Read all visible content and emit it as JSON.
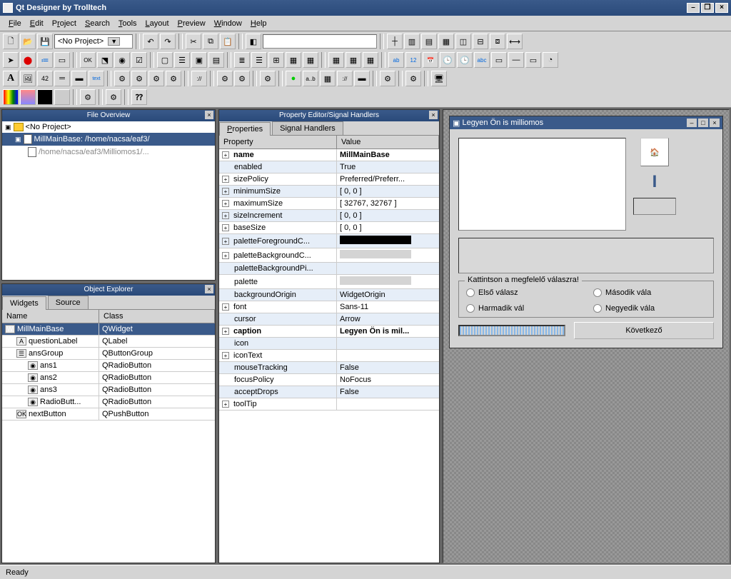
{
  "window": {
    "title": "Qt Designer by Trolltech"
  },
  "menus": [
    "File",
    "Edit",
    "Project",
    "Search",
    "Tools",
    "Layout",
    "Preview",
    "Window",
    "Help"
  ],
  "project_combo": "<No Project>",
  "panels": {
    "file_overview": {
      "title": "File Overview",
      "root": "<No Project>",
      "selected": "MillMainBase: /home/nacsa/eaf3/",
      "child": "/home/nacsa/eaf3/Milliomos1/..."
    },
    "object_explorer": {
      "title": "Object Explorer",
      "tabs": [
        "Widgets",
        "Source"
      ],
      "active_tab": 0,
      "columns": [
        "Name",
        "Class"
      ],
      "rows": [
        {
          "name": "MillMainBase",
          "class": "QWidget",
          "sel": true,
          "indent": 0,
          "icon": "W"
        },
        {
          "name": "questionLabel",
          "class": "QLabel",
          "sel": false,
          "indent": 1,
          "icon": "A"
        },
        {
          "name": "ansGroup",
          "class": "QButtonGroup",
          "sel": false,
          "indent": 1,
          "icon": "☰"
        },
        {
          "name": "ans1",
          "class": "QRadioButton",
          "sel": false,
          "indent": 2,
          "icon": "◉"
        },
        {
          "name": "ans2",
          "class": "QRadioButton",
          "sel": false,
          "indent": 2,
          "icon": "◉"
        },
        {
          "name": "ans3",
          "class": "QRadioButton",
          "sel": false,
          "indent": 2,
          "icon": "◉"
        },
        {
          "name": "RadioButt...",
          "class": "QRadioButton",
          "sel": false,
          "indent": 2,
          "icon": "◉"
        },
        {
          "name": "nextButton",
          "class": "QPushButton",
          "sel": false,
          "indent": 1,
          "icon": "OK"
        }
      ]
    },
    "property_editor": {
      "title": "Property Editor/Signal Handlers",
      "tabs": [
        "Properties",
        "Signal Handlers"
      ],
      "active_tab": 0,
      "columns": [
        "Property",
        "Value"
      ],
      "rows": [
        {
          "name": "name",
          "value": "MillMainBase",
          "bold": true,
          "expand": true,
          "alt": false
        },
        {
          "name": "enabled",
          "value": "True",
          "expand": false,
          "alt": true
        },
        {
          "name": "sizePolicy",
          "value": "Preferred/Preferr...",
          "expand": true,
          "alt": false
        },
        {
          "name": "minimumSize",
          "value": "[ 0, 0 ]",
          "expand": true,
          "alt": true
        },
        {
          "name": "maximumSize",
          "value": "[ 32767, 32767 ]",
          "expand": true,
          "alt": false
        },
        {
          "name": "sizeIncrement",
          "value": "[ 0, 0 ]",
          "expand": true,
          "alt": true
        },
        {
          "name": "baseSize",
          "value": "[ 0, 0 ]",
          "expand": true,
          "alt": false
        },
        {
          "name": "paletteForegroundC...",
          "value": "",
          "swatch": "#000000",
          "expand": true,
          "alt": true
        },
        {
          "name": "paletteBackgroundC...",
          "value": "",
          "swatch": "#d4d4d4",
          "expand": true,
          "alt": false
        },
        {
          "name": "paletteBackgroundPi...",
          "value": "",
          "expand": false,
          "alt": true
        },
        {
          "name": "palette",
          "value": "",
          "swatch": "#d4d4d4",
          "expand": false,
          "alt": false
        },
        {
          "name": "backgroundOrigin",
          "value": "WidgetOrigin",
          "expand": false,
          "alt": true
        },
        {
          "name": "font",
          "value": "Sans-11",
          "expand": true,
          "alt": false
        },
        {
          "name": "cursor",
          "value": "Arrow",
          "expand": false,
          "alt": true
        },
        {
          "name": "caption",
          "value": "Legyen Ön is mil...",
          "bold": true,
          "expand": true,
          "alt": false
        },
        {
          "name": "icon",
          "value": "",
          "expand": false,
          "alt": true
        },
        {
          "name": "iconText",
          "value": "",
          "expand": true,
          "alt": false
        },
        {
          "name": "mouseTracking",
          "value": "False",
          "expand": false,
          "alt": true
        },
        {
          "name": "focusPolicy",
          "value": "NoFocus",
          "expand": false,
          "alt": false
        },
        {
          "name": "acceptDrops",
          "value": "False",
          "expand": false,
          "alt": true
        },
        {
          "name": "toolTip",
          "value": "",
          "expand": true,
          "alt": false
        }
      ]
    }
  },
  "preview": {
    "title": "Legyen Ön is milliomos",
    "group_legend": "Kattintson a megfelelő válaszra!",
    "answers": [
      "Első válasz",
      "Második vála",
      "Harmadik vál",
      "Negyedik vála"
    ],
    "next_button": "Következő"
  },
  "status": "Ready"
}
